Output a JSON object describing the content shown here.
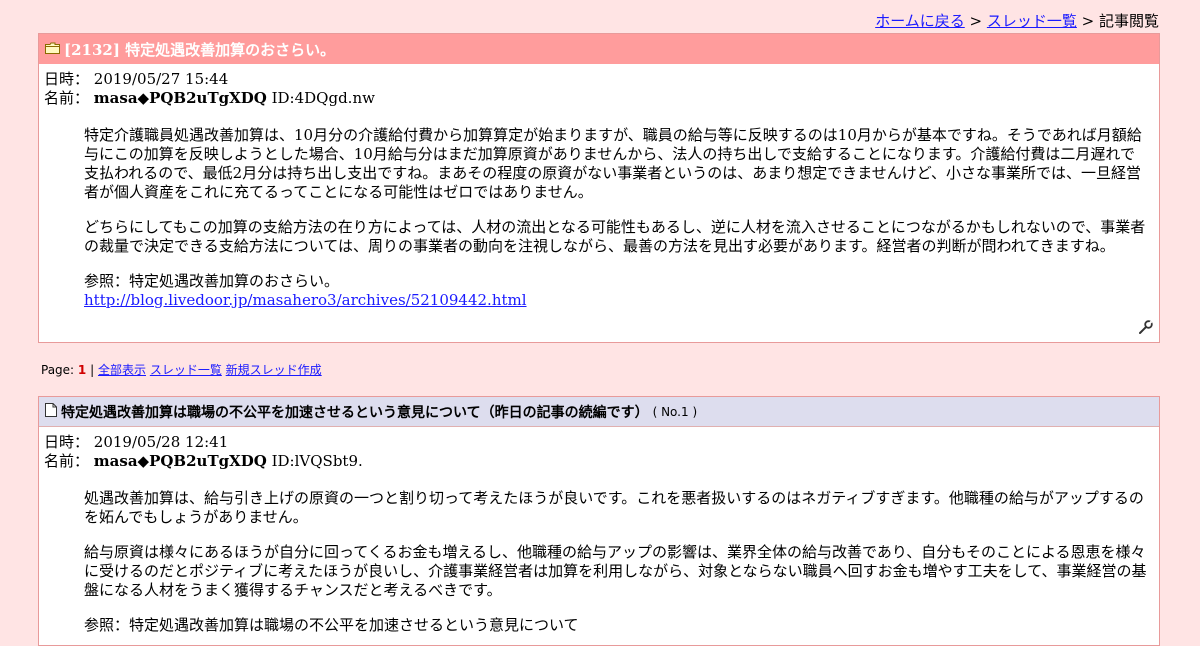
{
  "breadcrumb": {
    "home": "ホームに戻る",
    "sep1": " > ",
    "threads": "スレッド一覧",
    "sep2": " > ",
    "current": "記事閲覧"
  },
  "post1": {
    "title": "[2132] 特定処遇改善加算のおさらい。",
    "date_label": "日時：",
    "date": "2019/05/27 15:44",
    "name_label": "名前：",
    "name": "masa◆PQB2uTgXDQ",
    "id": "ID:4DQgd.nw",
    "paragraphs": [
      "特定介護職員処遇改善加算は、10月分の介護給付費から加算算定が始まりますが、職員の給与等に反映するのは10月からが基本ですね。そうであれば月額給与にこの加算を反映しようとした場合、10月給与分はまだ加算原資がありませんから、法人の持ち出しで支給することになります。介護給付費は二月遅れで支払われるので、最低2月分は持ち出し支出ですね。まあその程度の原資がない事業者というのは、あまり想定できませんけど、小さな事業所では、一旦経営者が個人資産をこれに充てるってことになる可能性はゼロではありません。",
      "どちらにしてもこの加算の支給方法の在り方によっては、人材の流出となる可能性もあるし、逆に人材を流入させることにつながるかもしれないので、事業者の裁量で決定できる支給方法については、周りの事業者の動向を注視しながら、最善の方法を見出す必要があります。経営者の判断が問われてきますね。"
    ],
    "ref_label": "参照：特定処遇改善加算のおさらい。",
    "ref_url": "http://blog.livedoor.jp/masahero3/archives/52109442.html"
  },
  "pager": {
    "label": "Page:",
    "current": "1",
    "sep": "|",
    "show_all": "全部表示",
    "thread_list": "スレッド一覧",
    "new_thread": "新規スレッド作成"
  },
  "post2": {
    "title": "特定処遇改善加算は職場の不公平を加速させるという意見について（昨日の記事の続編です）",
    "no": "( No.1 )",
    "date_label": "日時：",
    "date": "2019/05/28 12:41",
    "name_label": "名前：",
    "name": "masa◆PQB2uTgXDQ",
    "id": "ID:lVQSbt9.",
    "paragraphs": [
      "処遇改善加算は、給与引き上げの原資の一つと割り切って考えたほうが良いです。これを悪者扱いするのはネガティブすぎます。他職種の給与がアップするのを妬んでもしょうがありません。",
      "給与原資は様々にあるほうが自分に回ってくるお金も増えるし、他職種の給与アップの影響は、業界全体の給与改善であり、自分もそのことによる恩恵を様々に受けるのだとポジティブに考えたほうが良いし、介護事業経営者は加算を利用しながら、対象とならない職員へ回すお金も増やす工夫をして、事業経営の基盤になる人材をうまく獲得するチャンスだと考えるべきです。"
    ],
    "ref_label": "参照：特定処遇改善加算は職場の不公平を加速させるという意見について"
  },
  "icons": {
    "post1": "folder-icon",
    "post2": "document-icon",
    "edit": "wrench-icon"
  }
}
